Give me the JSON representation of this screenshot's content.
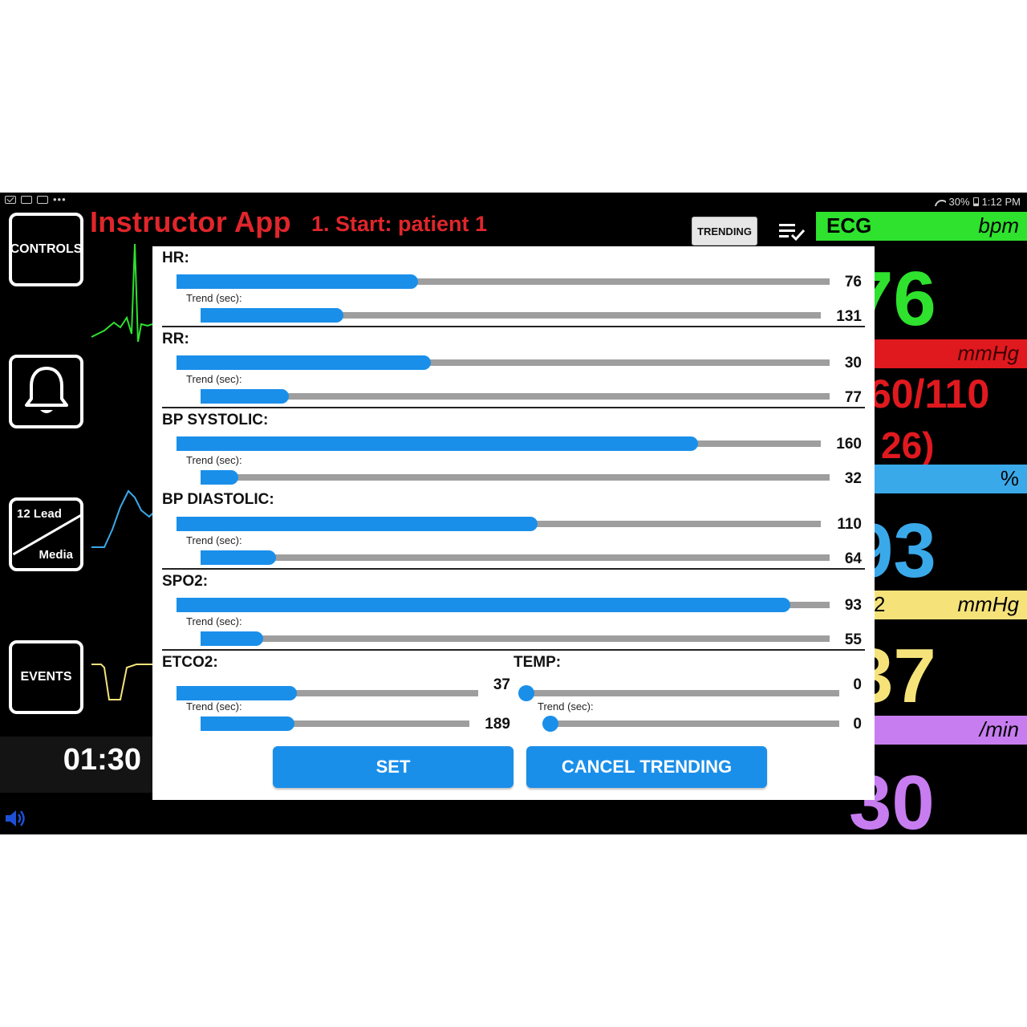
{
  "status_bar": {
    "battery": "30%",
    "time": "1:12 PM",
    "more": "•••"
  },
  "sidebar": {
    "controls_label": "CONTROLS",
    "lead_top": "12 Lead",
    "lead_bottom": "Media",
    "events_label": "EVENTS",
    "timer": "01:30"
  },
  "header": {
    "app_title": "Instructor App",
    "scenario": "1. Start: patient 1",
    "trending_label": "TRENDING"
  },
  "vitals": {
    "ecg_name": "ECG",
    "ecg_unit": "bpm",
    "hr_value": "76",
    "bp_unit": "mmHg",
    "bp_value": "60/110",
    "map_value": "26)",
    "spo2_unit": "%",
    "spo2_value": "93",
    "co2_peek": "2",
    "co2_unit": "mmHg",
    "co2_value": "37",
    "rr_unit": "/min",
    "rr_value": "30",
    "colors": {
      "ecg": "#2ee22e",
      "bp": "#e0191f",
      "spo2": "#3aa9ea",
      "co2": "#f5e37a",
      "rr": "#c77df0"
    }
  },
  "dialog": {
    "trend_label": "Trend (sec):",
    "hr": {
      "title": "HR:",
      "value": "76",
      "level": 0.37,
      "trend": "131",
      "trend_level": 0.23
    },
    "rr": {
      "title": "RR:",
      "value": "30",
      "level": 0.39,
      "trend": "77",
      "trend_level": 0.14
    },
    "bp_sys": {
      "title": "BP SYSTOLIC:",
      "value": "160",
      "level": 0.81,
      "trend": "32",
      "trend_level": 0.06
    },
    "bp_dia": {
      "title": "BP DIASTOLIC:",
      "value": "110",
      "level": 0.56,
      "trend": "64",
      "trend_level": 0.12
    },
    "spo2": {
      "title": "SPO2:",
      "value": "93",
      "level": 0.94,
      "trend": "55",
      "trend_level": 0.1
    },
    "etco2": {
      "title": "ETCO2:",
      "value": "37",
      "level": 0.4,
      "trend": "189",
      "trend_level": 0.35
    },
    "temp": {
      "title": "TEMP:",
      "value": "0",
      "level": 0,
      "trend": "0",
      "trend_level": 0
    },
    "set_label": "SET",
    "cancel_label": "CANCEL TRENDING",
    "accent": "#1a8fea"
  }
}
